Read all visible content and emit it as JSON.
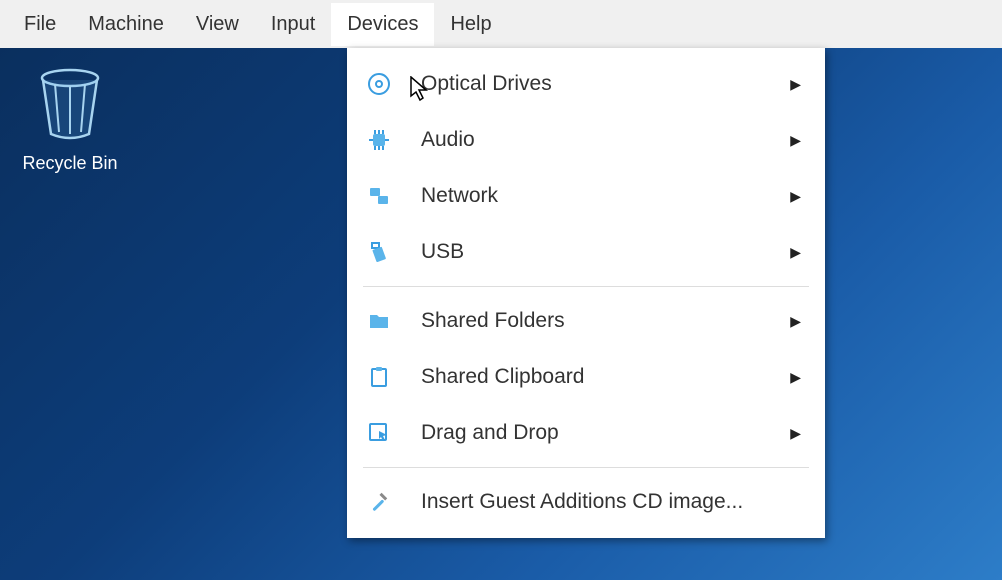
{
  "menubar": {
    "items": [
      {
        "label": "File"
      },
      {
        "label": "Machine"
      },
      {
        "label": "View"
      },
      {
        "label": "Input"
      },
      {
        "label": "Devices"
      },
      {
        "label": "Help"
      }
    ]
  },
  "desktop": {
    "icons": [
      {
        "label": "Recycle Bin"
      }
    ]
  },
  "dropdown": {
    "items": [
      {
        "label": "Optical Drives",
        "icon": "disc",
        "submenu": true
      },
      {
        "label": "Audio",
        "icon": "chip",
        "submenu": true
      },
      {
        "label": "Network",
        "icon": "network",
        "submenu": true
      },
      {
        "label": "USB",
        "icon": "usb",
        "submenu": true
      },
      {
        "separator": true
      },
      {
        "label": "Shared Folders",
        "icon": "folder",
        "submenu": true
      },
      {
        "label": "Shared Clipboard",
        "icon": "clipboard",
        "submenu": true
      },
      {
        "label": "Drag and Drop",
        "icon": "dragdrop",
        "submenu": true
      },
      {
        "separator": true
      },
      {
        "label": "Insert Guest Additions CD image...",
        "icon": "screwdriver",
        "submenu": false
      }
    ]
  }
}
